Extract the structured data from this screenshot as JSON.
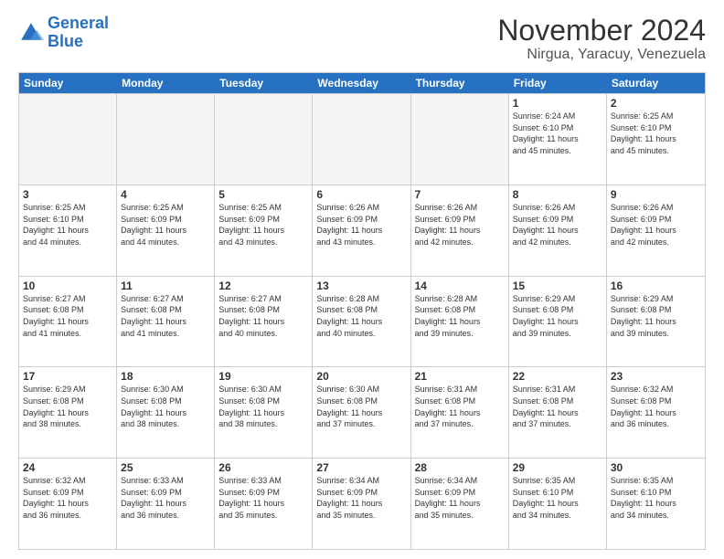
{
  "header": {
    "logo_line1": "General",
    "logo_line2": "Blue",
    "month": "November 2024",
    "location": "Nirgua, Yaracuy, Venezuela"
  },
  "days_of_week": [
    "Sunday",
    "Monday",
    "Tuesday",
    "Wednesday",
    "Thursday",
    "Friday",
    "Saturday"
  ],
  "weeks": [
    [
      {
        "day": "",
        "empty": true
      },
      {
        "day": "",
        "empty": true
      },
      {
        "day": "",
        "empty": true
      },
      {
        "day": "",
        "empty": true
      },
      {
        "day": "",
        "empty": true
      },
      {
        "day": "1",
        "rise": "6:24 AM",
        "set": "6:10 PM",
        "daylight": "11 hours and 45 minutes."
      },
      {
        "day": "2",
        "rise": "6:25 AM",
        "set": "6:10 PM",
        "daylight": "11 hours and 45 minutes."
      }
    ],
    [
      {
        "day": "3",
        "rise": "6:25 AM",
        "set": "6:10 PM",
        "daylight": "11 hours and 44 minutes."
      },
      {
        "day": "4",
        "rise": "6:25 AM",
        "set": "6:09 PM",
        "daylight": "11 hours and 44 minutes."
      },
      {
        "day": "5",
        "rise": "6:25 AM",
        "set": "6:09 PM",
        "daylight": "11 hours and 43 minutes."
      },
      {
        "day": "6",
        "rise": "6:26 AM",
        "set": "6:09 PM",
        "daylight": "11 hours and 43 minutes."
      },
      {
        "day": "7",
        "rise": "6:26 AM",
        "set": "6:09 PM",
        "daylight": "11 hours and 42 minutes."
      },
      {
        "day": "8",
        "rise": "6:26 AM",
        "set": "6:09 PM",
        "daylight": "11 hours and 42 minutes."
      },
      {
        "day": "9",
        "rise": "6:26 AM",
        "set": "6:09 PM",
        "daylight": "11 hours and 42 minutes."
      }
    ],
    [
      {
        "day": "10",
        "rise": "6:27 AM",
        "set": "6:08 PM",
        "daylight": "11 hours and 41 minutes."
      },
      {
        "day": "11",
        "rise": "6:27 AM",
        "set": "6:08 PM",
        "daylight": "11 hours and 41 minutes."
      },
      {
        "day": "12",
        "rise": "6:27 AM",
        "set": "6:08 PM",
        "daylight": "11 hours and 40 minutes."
      },
      {
        "day": "13",
        "rise": "6:28 AM",
        "set": "6:08 PM",
        "daylight": "11 hours and 40 minutes."
      },
      {
        "day": "14",
        "rise": "6:28 AM",
        "set": "6:08 PM",
        "daylight": "11 hours and 39 minutes."
      },
      {
        "day": "15",
        "rise": "6:29 AM",
        "set": "6:08 PM",
        "daylight": "11 hours and 39 minutes."
      },
      {
        "day": "16",
        "rise": "6:29 AM",
        "set": "6:08 PM",
        "daylight": "11 hours and 39 minutes."
      }
    ],
    [
      {
        "day": "17",
        "rise": "6:29 AM",
        "set": "6:08 PM",
        "daylight": "11 hours and 38 minutes."
      },
      {
        "day": "18",
        "rise": "6:30 AM",
        "set": "6:08 PM",
        "daylight": "11 hours and 38 minutes."
      },
      {
        "day": "19",
        "rise": "6:30 AM",
        "set": "6:08 PM",
        "daylight": "11 hours and 38 minutes."
      },
      {
        "day": "20",
        "rise": "6:30 AM",
        "set": "6:08 PM",
        "daylight": "11 hours and 37 minutes."
      },
      {
        "day": "21",
        "rise": "6:31 AM",
        "set": "6:08 PM",
        "daylight": "11 hours and 37 minutes."
      },
      {
        "day": "22",
        "rise": "6:31 AM",
        "set": "6:08 PM",
        "daylight": "11 hours and 37 minutes."
      },
      {
        "day": "23",
        "rise": "6:32 AM",
        "set": "6:08 PM",
        "daylight": "11 hours and 36 minutes."
      }
    ],
    [
      {
        "day": "24",
        "rise": "6:32 AM",
        "set": "6:09 PM",
        "daylight": "11 hours and 36 minutes."
      },
      {
        "day": "25",
        "rise": "6:33 AM",
        "set": "6:09 PM",
        "daylight": "11 hours and 36 minutes."
      },
      {
        "day": "26",
        "rise": "6:33 AM",
        "set": "6:09 PM",
        "daylight": "11 hours and 35 minutes."
      },
      {
        "day": "27",
        "rise": "6:34 AM",
        "set": "6:09 PM",
        "daylight": "11 hours and 35 minutes."
      },
      {
        "day": "28",
        "rise": "6:34 AM",
        "set": "6:09 PM",
        "daylight": "11 hours and 35 minutes."
      },
      {
        "day": "29",
        "rise": "6:35 AM",
        "set": "6:10 PM",
        "daylight": "11 hours and 34 minutes."
      },
      {
        "day": "30",
        "rise": "6:35 AM",
        "set": "6:10 PM",
        "daylight": "11 hours and 34 minutes."
      }
    ]
  ],
  "labels": {
    "sunrise": "Sunrise:",
    "sunset": "Sunset:",
    "daylight": "Daylight:"
  }
}
